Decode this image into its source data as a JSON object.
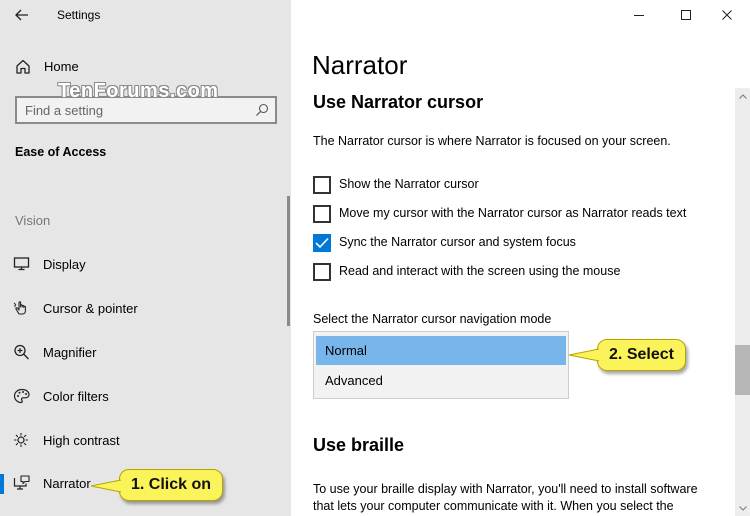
{
  "window": {
    "title": "Settings",
    "controls": {
      "minimize": "minimize",
      "maximize": "maximize",
      "close": "close"
    }
  },
  "sidebar": {
    "home_label": "Home",
    "search": {
      "placeholder": "Find a setting",
      "value": ""
    },
    "section_title": "Ease of Access",
    "group_label": "Vision",
    "items": [
      {
        "label": "Display",
        "icon": "monitor-icon",
        "selected": false
      },
      {
        "label": "Cursor & pointer",
        "icon": "pointer-hand-icon",
        "selected": false
      },
      {
        "label": "Magnifier",
        "icon": "magnifier-icon",
        "selected": false
      },
      {
        "label": "Color filters",
        "icon": "palette-icon",
        "selected": false
      },
      {
        "label": "High contrast",
        "icon": "brightness-icon",
        "selected": false
      },
      {
        "label": "Narrator",
        "icon": "narrator-icon",
        "selected": true
      }
    ]
  },
  "watermark": "TenForums.com",
  "main": {
    "page_title": "Narrator",
    "cursor_section": {
      "heading": "Use Narrator cursor",
      "description": "The Narrator cursor is where Narrator is focused on your screen.",
      "checkboxes": [
        {
          "label": "Show the Narrator cursor",
          "checked": false
        },
        {
          "label": "Move my cursor with the Narrator cursor as Narrator reads text",
          "checked": false
        },
        {
          "label": "Sync the Narrator cursor and system focus",
          "checked": true
        },
        {
          "label": "Read and interact with the screen using the mouse",
          "checked": false
        }
      ],
      "dropdown": {
        "label": "Select the Narrator cursor navigation mode",
        "options": [
          {
            "label": "Normal",
            "selected": true
          },
          {
            "label": "Advanced",
            "selected": false
          }
        ]
      }
    },
    "braille_section": {
      "heading": "Use braille",
      "paragraph": "To use your braille display with Narrator, you'll need to install software that lets your computer communicate with it. When you select the"
    }
  },
  "callouts": {
    "step1": "1. Click on",
    "step2": "2. Select",
    "color": "#fbf35a"
  },
  "colors": {
    "accent": "#0078d7",
    "sidebar_bg": "#e6e6e6",
    "dropdown_selected": "#78b5ea"
  }
}
